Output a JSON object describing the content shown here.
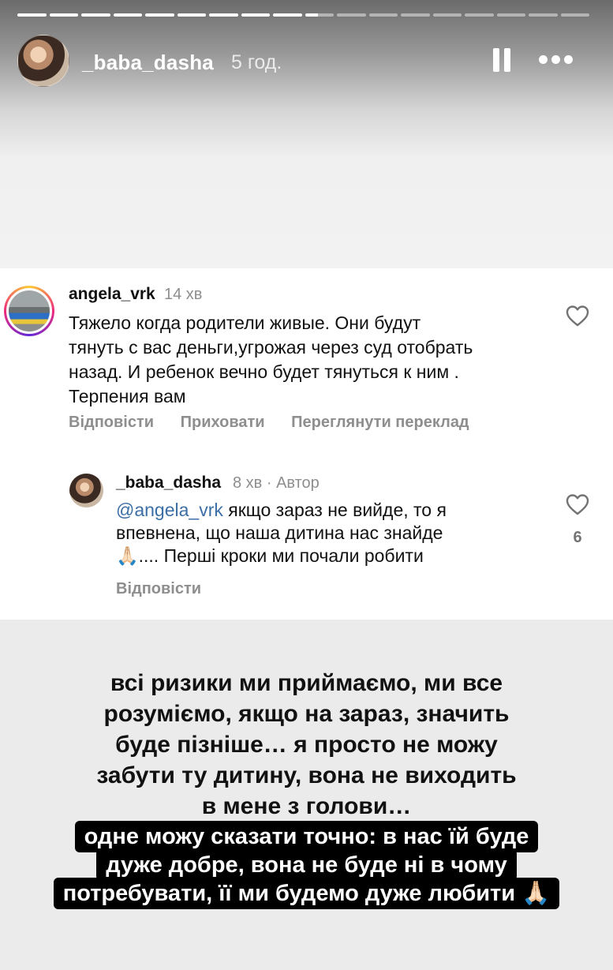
{
  "story": {
    "username": "_baba_dasha",
    "time": "5 год.",
    "progress_segments": 18,
    "segments_viewed": 9,
    "current_segment_progress": 0.45,
    "icons": {
      "pause": "pause-icon",
      "more": "more-icon"
    }
  },
  "comment": {
    "username": "angela_vrk",
    "time": "14 хв",
    "lines": [
      "Тяжело когда родители живые. Они будут",
      "тянуть с вас деньги,угрожая через суд отобрать",
      "назад. И ребенок вечно будет тянуться к ним .",
      "Терпения вам"
    ],
    "actions": [
      "Відповісти",
      "Приховати",
      "Переглянути переклад"
    ],
    "like_icon": "heart-icon"
  },
  "reply": {
    "username": "_baba_dasha",
    "meta": "8 хв · Автор",
    "mention": "@angela_vrk",
    "line1_rest": " якщо зараз не вийде, то я",
    "line2": "впевнена, що наша дитина нас знайде",
    "line3": "🙏🏻.... Перші кроки ми почали робити",
    "reply_action": "Відповісти",
    "like_count": "6",
    "like_icon": "heart-icon"
  },
  "caption_lines": [
    "всі ризики ми приймаємо, ми все",
    "розуміємо, якщо на зараз, значить",
    "буде пізніше… я просто не можу",
    "забути ту дитину, вона не виходить",
    "в мене з голови…"
  ],
  "highlight_lines": [
    "одне можу сказати точно: в нас їй буде",
    "дуже добре, вона не буде ні в чому",
    "потребувати, її ми будемо дуже любити 🙏🏻"
  ]
}
